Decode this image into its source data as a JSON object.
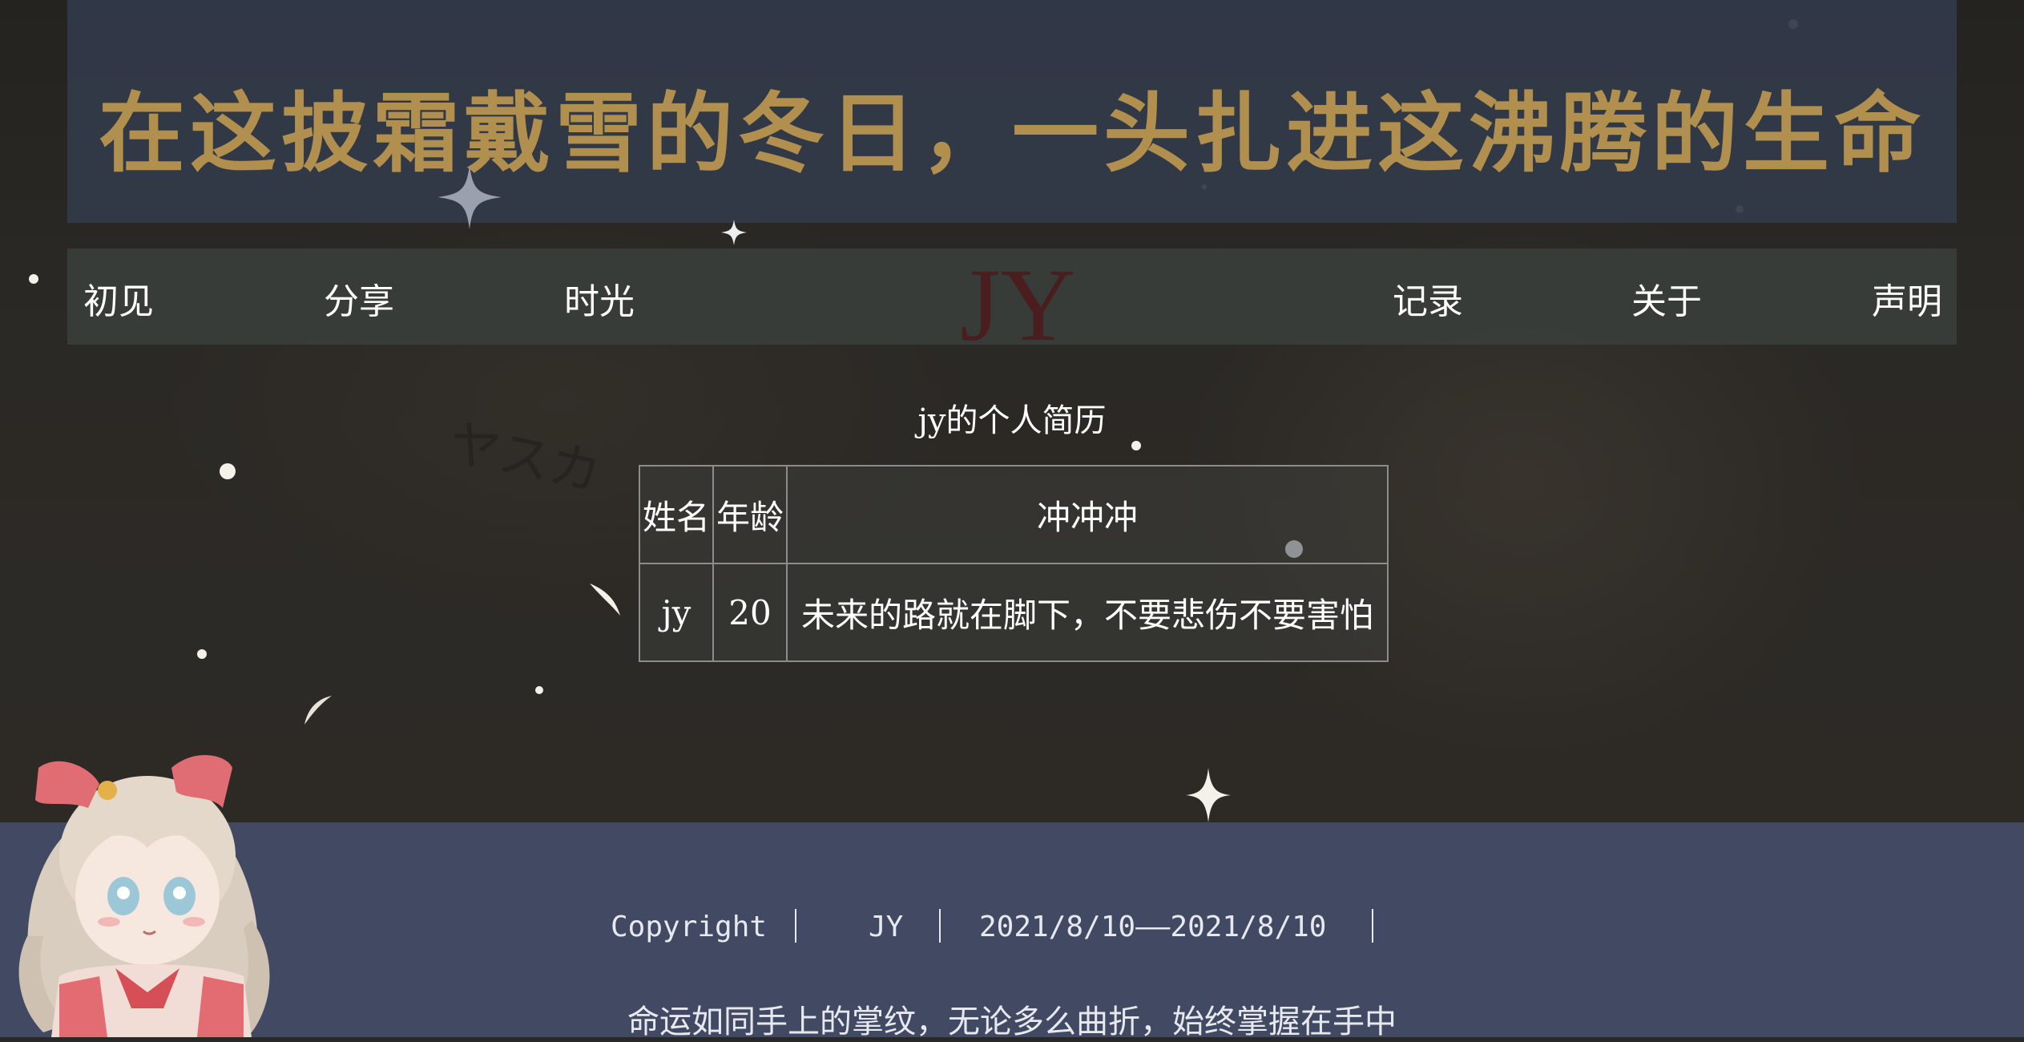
{
  "banner": {
    "text": "在这披霜戴雪的冬日，一头扎进这沸腾的生命"
  },
  "nav": {
    "items": [
      "初见",
      "分享",
      "时光",
      "记录",
      "关于",
      "声明"
    ],
    "logo": "JY"
  },
  "resume": {
    "title": "jy的个人简历",
    "headers": [
      "姓名",
      "年龄",
      "冲冲冲"
    ],
    "row": [
      "jy",
      "20",
      "未来的路就在脚下，不要悲伤不要害怕"
    ]
  },
  "footer": {
    "copyright": "Copyright",
    "author": "JY",
    "date_range": "2021/8/10——2021/8/10",
    "motto": "命运如同手上的掌纹，无论多么曲折，始终掌握在手中"
  },
  "colors": {
    "banner_bg": "#32394a",
    "banner_text": "#b08f4f",
    "logo": "#4a1e1e",
    "footer_bg": "#414a62"
  }
}
